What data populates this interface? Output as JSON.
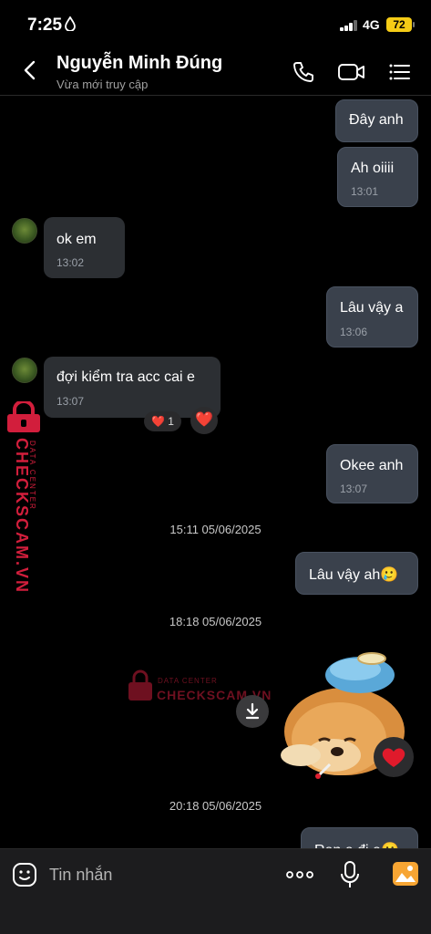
{
  "status_bar": {
    "time": "7:25",
    "network": "4G",
    "battery": "72",
    "battery_color": "#f5cc16"
  },
  "header": {
    "contact_name": "Nguyễn Minh Đúng",
    "last_seen": "Vừa mới truy cập",
    "icons": [
      "back-chevron-icon",
      "phone-icon",
      "video-call-icon",
      "menu-list-icon"
    ]
  },
  "messages": [
    {
      "dir": "out",
      "text": "Đây anh",
      "time": ""
    },
    {
      "dir": "out",
      "text": "Ah oiiii",
      "time": "13:01"
    },
    {
      "dir": "in",
      "text": "ok em",
      "time": "13:02"
    },
    {
      "dir": "out",
      "text": "Lâu vậy a",
      "time": "13:06"
    },
    {
      "dir": "in",
      "text": "đợi kiểm tra acc cai e",
      "time": "13:07",
      "reaction_count": "1"
    },
    {
      "dir": "out",
      "text": "Okee anh",
      "time": "13:07"
    },
    {
      "dir": "out",
      "text": "Lâu vậy ah🥲",
      "time": ""
    },
    {
      "dir": "out",
      "text": "Ren e đi e🥲",
      "time": ""
    }
  ],
  "separators": [
    "15:11 05/06/2025",
    "18:18 05/06/2025",
    "20:18 05/06/2025"
  ],
  "watermark": {
    "brand": "CHECKSCAM.VN",
    "tagline": "DATA CENTER",
    "color": "#d21e3c"
  },
  "composer": {
    "placeholder": "Tin nhắn",
    "icons": [
      "sticker-icon",
      "more-icon",
      "microphone-icon",
      "image-icon"
    ]
  },
  "colors": {
    "background": "#000000",
    "bubble_outgoing": "#3a414c",
    "bubble_incoming": "#2c2f33",
    "heart": "#e01a2b",
    "image_icon": "#f7a533"
  }
}
